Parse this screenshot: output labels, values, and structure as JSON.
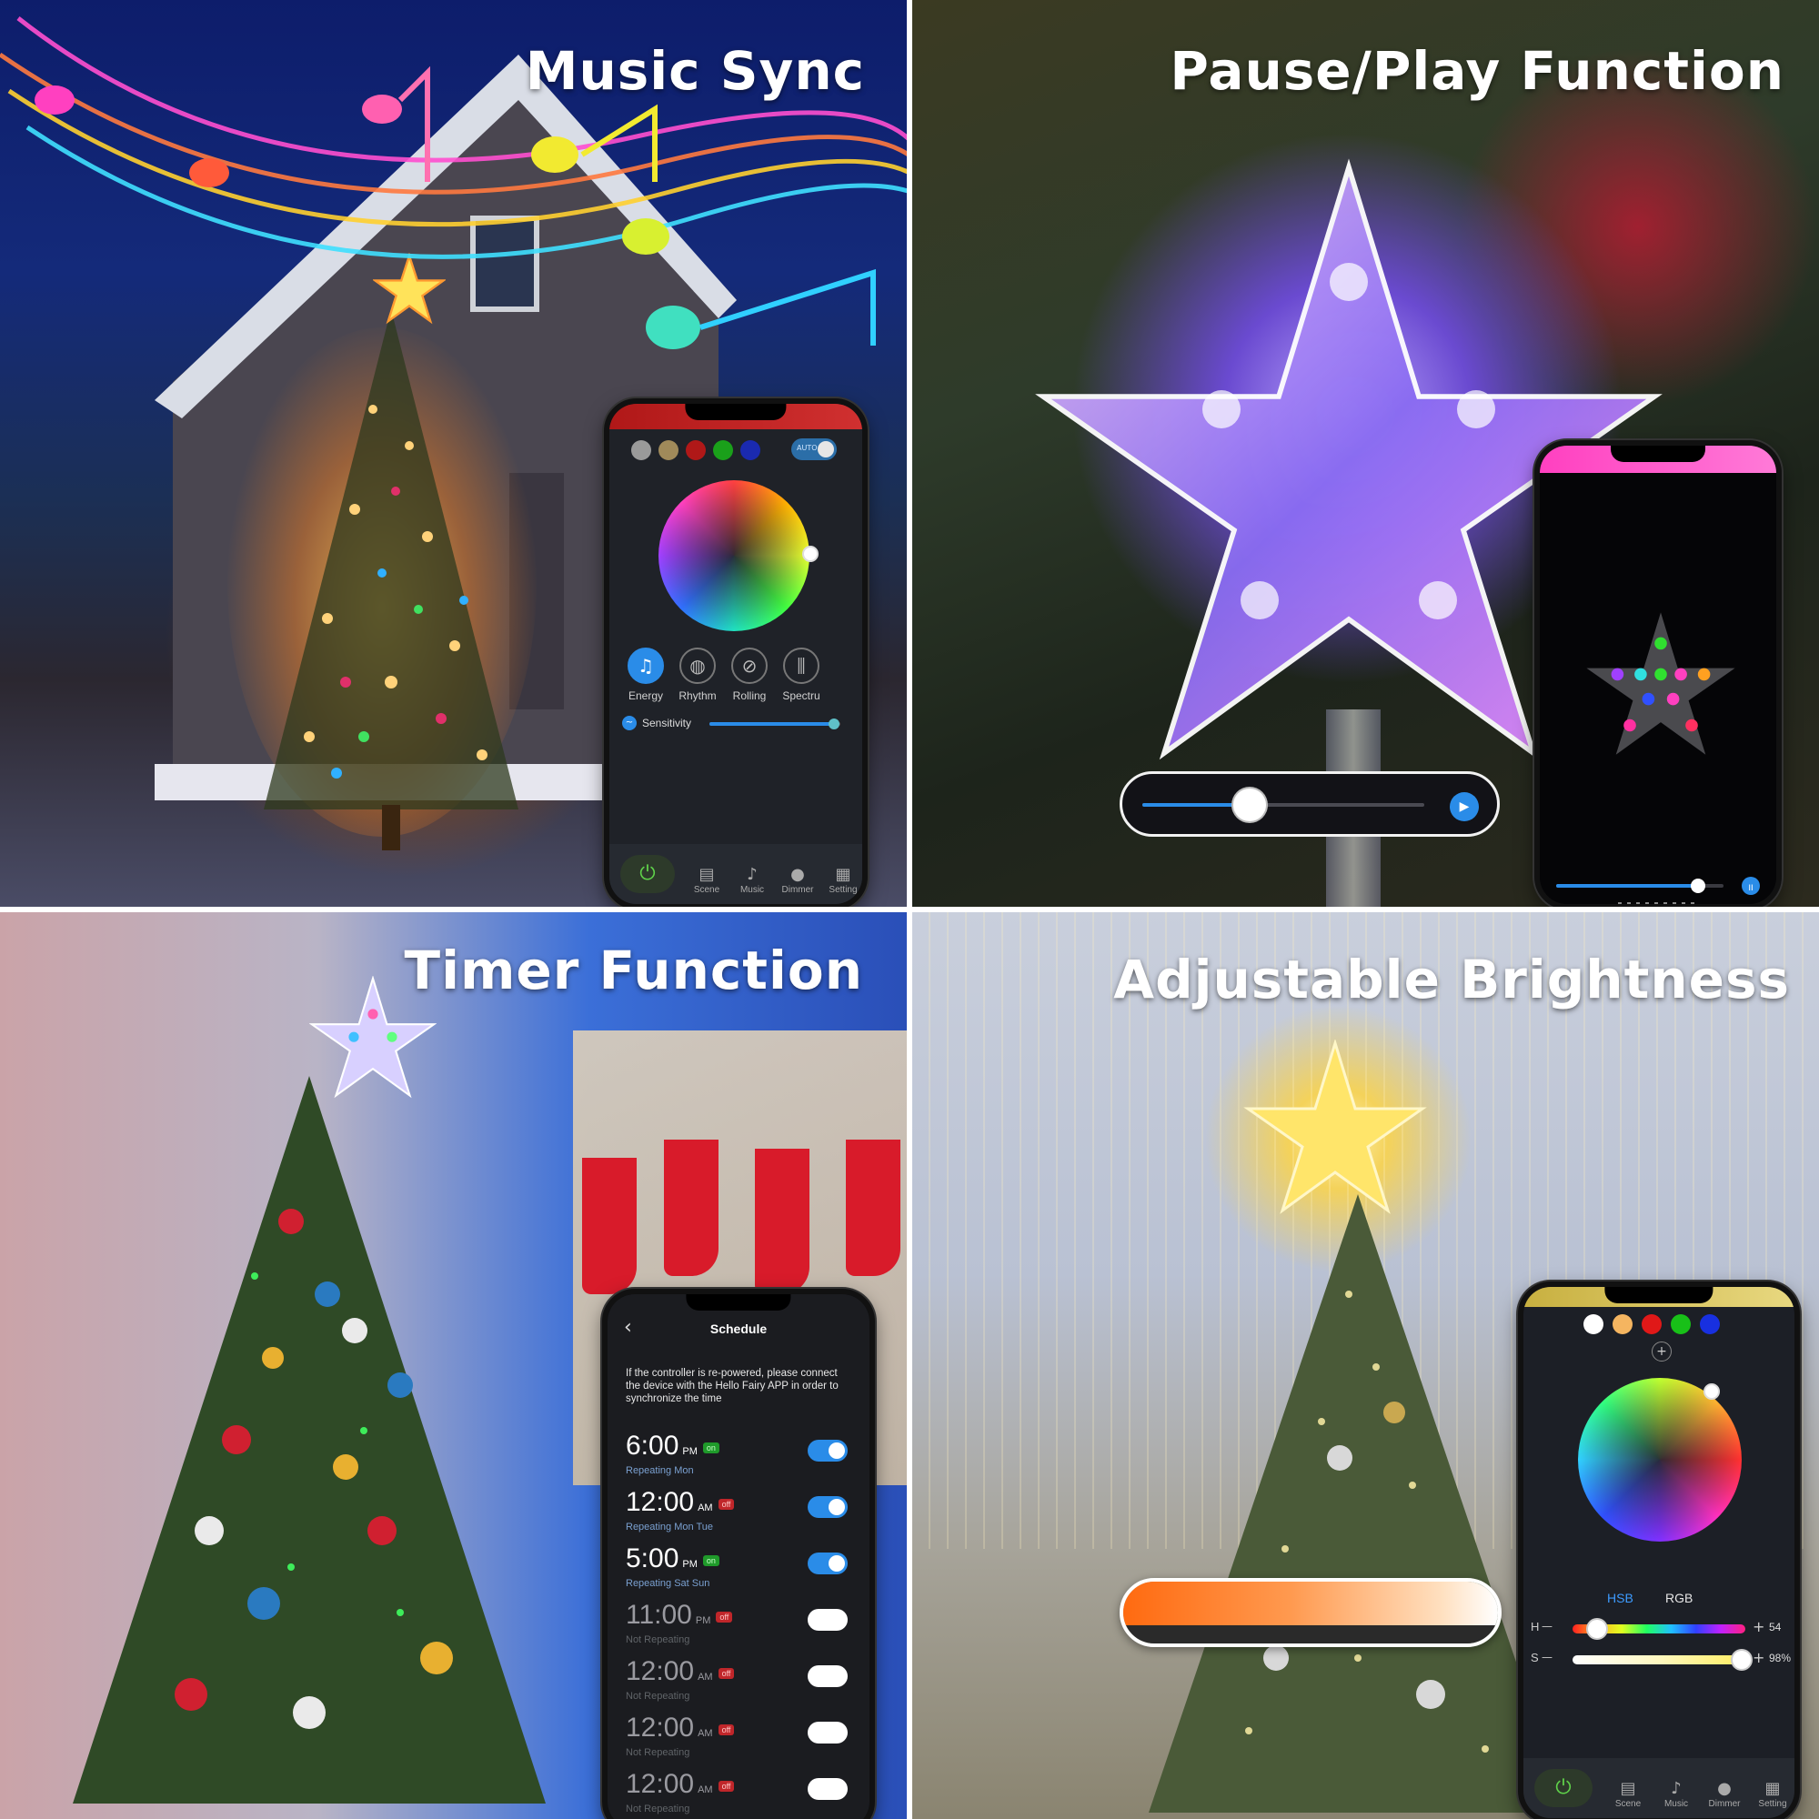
{
  "panels": {
    "music": {
      "title": "Music Sync",
      "swatches": [
        "#9a9a9a",
        "#a08a5a",
        "#b01818",
        "#1aa01a",
        "#1a2ab0"
      ],
      "auto_label": "AUTO",
      "modes": [
        {
          "label": "Energy",
          "icon": "energy-icon",
          "glyph": "♫",
          "active": true
        },
        {
          "label": "Rhythm",
          "icon": "drum-icon",
          "glyph": "◍",
          "active": false
        },
        {
          "label": "Rolling",
          "icon": "rolling-icon",
          "glyph": "⊘",
          "active": false
        },
        {
          "label": "Spectru",
          "icon": "spectrum-icon",
          "glyph": "⫼",
          "active": false
        }
      ],
      "sensitivity_label": "Sensitivity",
      "sensitivity_level": 0.95,
      "tabs": [
        {
          "label": "Scene",
          "icon": "scene-icon",
          "glyph": "▤"
        },
        {
          "label": "Music",
          "icon": "music-icon",
          "glyph": "♪"
        },
        {
          "label": "Dimmer",
          "icon": "bulb-icon",
          "glyph": "●"
        },
        {
          "label": "Setting",
          "icon": "grid-icon",
          "glyph": "▦"
        }
      ],
      "power_glyph": "⏻"
    },
    "pause": {
      "title": "Pause/Play Function",
      "progress": 0.38,
      "phone_progress": 0.85,
      "play_glyph": "▶",
      "pause_glyph": "II"
    },
    "timer": {
      "title": "Timer Function",
      "screen_title": "Schedule",
      "back_glyph": "‹",
      "notice": "If the controller is re-powered, please connect the device with the Hello Fairy APP in order to synchronize the time",
      "rows": [
        {
          "time": "6:00",
          "ampm": "PM",
          "badge": "on",
          "sub": "Repeating Mon",
          "enabled": true
        },
        {
          "time": "12:00",
          "ampm": "AM",
          "badge": "off",
          "sub": "Repeating Mon Tue",
          "enabled": true
        },
        {
          "time": "5:00",
          "ampm": "PM",
          "badge": "on",
          "sub": "Repeating Sat Sun",
          "enabled": true
        },
        {
          "time": "11:00",
          "ampm": "PM",
          "badge": "off",
          "sub": "Not Repeating",
          "enabled": false
        },
        {
          "time": "12:00",
          "ampm": "AM",
          "badge": "off",
          "sub": "Not Repeating",
          "enabled": false
        },
        {
          "time": "12:00",
          "ampm": "AM",
          "badge": "off",
          "sub": "Not Repeating",
          "enabled": false
        },
        {
          "time": "12:00",
          "ampm": "AM",
          "badge": "off",
          "sub": "Not Repeating",
          "enabled": false
        }
      ]
    },
    "brightness": {
      "title": "Adjustable Brightness",
      "swatches": [
        "#ffffff",
        "#f5b560",
        "#e01818",
        "#18c018",
        "#1830e0"
      ],
      "add_glyph": "+",
      "mode_hsb": "HSB",
      "mode_rgb": "RGB",
      "h_label": "H",
      "h_value": "54",
      "h_level": 0.14,
      "s_label": "S",
      "s_value": "98%",
      "s_level": 0.98,
      "minus_glyph": "—",
      "plus_glyph": "+",
      "tabs": [
        {
          "label": "Scene",
          "icon": "scene-icon",
          "glyph": "▤"
        },
        {
          "label": "Music",
          "icon": "music-icon",
          "glyph": "♪"
        },
        {
          "label": "Dimmer",
          "icon": "bulb-icon",
          "glyph": "●"
        },
        {
          "label": "Setting",
          "icon": "grid-icon",
          "glyph": "▦"
        }
      ],
      "power_glyph": "⏻"
    }
  },
  "colors": {
    "accent_blue": "#2a8ce8",
    "on_green": "#1f9a2a",
    "off_red": "#c0262a",
    "power_green": "#5fd14a"
  }
}
